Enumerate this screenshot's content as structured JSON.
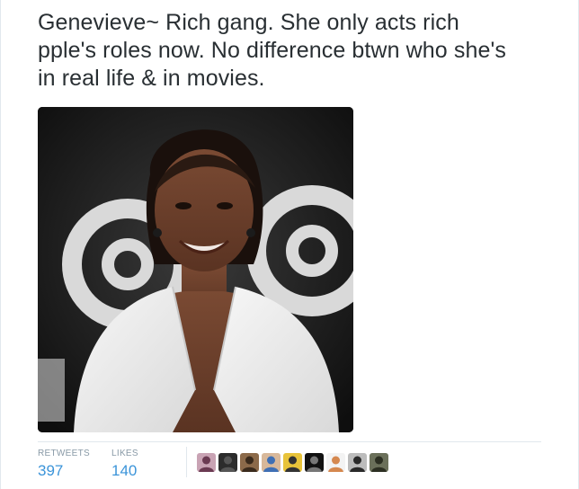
{
  "tweet": {
    "lines": [
      "Genevieve~ Rich gang. She only acts rich",
      "pple's roles now. No difference btwn who she's",
      "in real life & in movies."
    ]
  },
  "media": {
    "icon": "photo-woman-white-dress"
  },
  "stats": {
    "retweets_label": "RETWEETS",
    "retweets_value": "397",
    "likes_label": "LIKES",
    "likes_value": "140"
  },
  "avatars": [
    {
      "icon": "avatar-1",
      "bg": "#c9a3b4",
      "fg": "#6b3a52"
    },
    {
      "icon": "avatar-2",
      "bg": "#2c2c2c",
      "fg": "#555555"
    },
    {
      "icon": "avatar-3",
      "bg": "#8c6a4a",
      "fg": "#3a2a1c"
    },
    {
      "icon": "avatar-4",
      "bg": "#d8b89a",
      "fg": "#3f6fb4"
    },
    {
      "icon": "avatar-5",
      "bg": "#e8c33a",
      "fg": "#333333"
    },
    {
      "icon": "avatar-6",
      "bg": "#111111",
      "fg": "#777777"
    },
    {
      "icon": "avatar-7",
      "bg": "#f3f3f3",
      "fg": "#d5884f"
    },
    {
      "icon": "avatar-8",
      "bg": "#bcbcbc",
      "fg": "#2a2a2a"
    },
    {
      "icon": "avatar-9",
      "bg": "#6b705a",
      "fg": "#2c2f22"
    }
  ],
  "colors": {
    "text": "#292f33",
    "link": "#3b94d9",
    "muted": "#8899a6",
    "border": "#e1e8ed"
  }
}
